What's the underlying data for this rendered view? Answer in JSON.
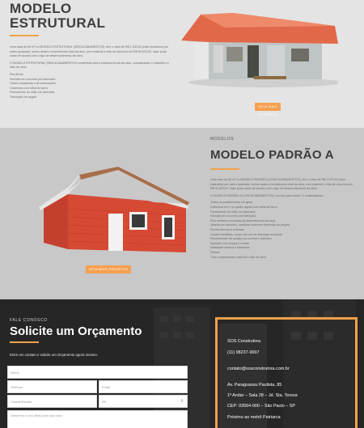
{
  "section1": {
    "title": "MODELO ESTRUTURAL",
    "paragraphs": [
      "Uma casa de 60 m² no MODELO ESTRUTURAL (SEM ACABAMENTOS), tem o valor de R$ 1.300,00 (valor ilustrativo) por metro quadrado, sendo assim o investimento total da obra, com material e mão de obra fica em R$ 60.000,00. Valor pode variar de acordo com o tipo de desenvolvimento da obra.",
      "O MODELO ESTRUTURAL (SEM ACABAMENTOS) contempla toda a estrutura bruta da casa, considerando o material e a mão de obra:",
      "Piso Bruto\nParedes em concreto pré-fabricado\nCintas soldadoras e de amarrações\nCobertura com telha de barro\nFechamento do oitão em alvenaria\nTubulação de esgoto"
    ],
    "button": "VEJA MAIS PROJETOS"
  },
  "section2": {
    "kicker": "MODELOS",
    "title": "MODELO PADRÃO A",
    "paragraphs": [
      "Uma casa de 60 m² no MODELO PADRÃO A (COM ACABAMENTOS), tem o valor de R$ 1.570,00 (valor ilustrativo) por metro quadrado, sendo assim o investimento total da obra, com material e mão de obra fica em R$ 94.200,00. Valor pode variar de acordo com o tipo de desenvolvimento da obra.",
      "O MODELO PADRÃO A (COM ACABAMENTOS) é pronto para morar. O contemplando:",
      "Todos os acabamentos em geral\nCobertura em 2 ou quatro águas com telha de barro\nFechamento do oitão em alvenaria\nParedes em concreto pré-fabricado\nPiso cerâmico em todas as dependências da casa\nJanelas em alumínio, medidas conforme dimensão do projeto\nPortas internas e externas\nGrades metálicas, inoxo com cor de descarga acoplada\nRevestimento de azulejo na cozinha e banheiro\nSanitário com louças e metais\nInstalação elétrica e hidráulica\nPintura\nTudo considerando material e mão de obra"
    ],
    "button": "VEJA MAIS PROJETOS"
  },
  "section3": {
    "kicker": "FALE CONOSCO",
    "title": "Solicite um Orçamento",
    "lead": "Entre em contato e solicite um Orçamento agora mesmo.",
    "form": {
      "name": "Nome",
      "phone": "Telefone",
      "email": "Email",
      "city": "Cidade/Estado",
      "state": "SP",
      "message": "Descreva o seu ideal para sua casa"
    },
    "contact": {
      "company": "SOS Construtora",
      "phone": "(11) 98237-9007",
      "email": "contato@sosconstrutora.com.br",
      "address1": "Av. Paraguassu Paulista, 85",
      "address2": "1º Andar – Sala 28 – Jd. Sta. Tereza",
      "cep": "CEP: 03564-000 – São Paulo – SP",
      "reference": "Próximo ao metrô Patriarca"
    }
  },
  "colors": {
    "accent": "#f0a24a",
    "dark": "#262626"
  }
}
